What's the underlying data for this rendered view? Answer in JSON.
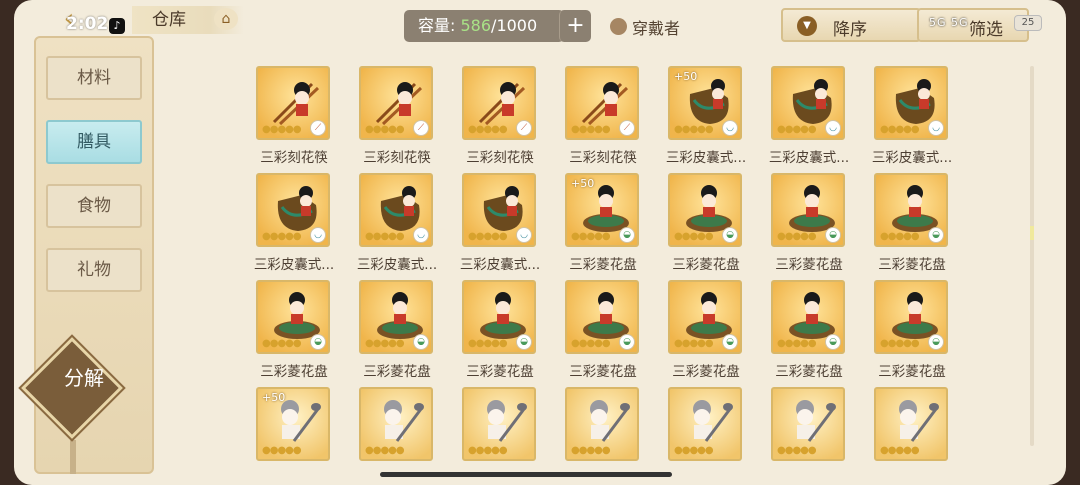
{
  "status": {
    "time": "2:02",
    "battery": "25",
    "signal": "5G 5G"
  },
  "header": {
    "back_icon": "back-arrow-icon",
    "title": "仓库",
    "capacity_label": "容量:",
    "capacity_used": "586",
    "capacity_total": "/1000",
    "add_label": "+",
    "wearer_label": "穿戴者",
    "sort_label": "降序",
    "filter_label": "筛选"
  },
  "sidebar": {
    "tabs": [
      {
        "label": "材料",
        "active": false
      },
      {
        "label": "膳具",
        "active": true
      },
      {
        "label": "食物",
        "active": false
      },
      {
        "label": "礼物",
        "active": false
      }
    ],
    "decompose_label": "分解"
  },
  "items": [
    {
      "name": "三彩刻花筷",
      "type": "chopsticks",
      "plus": "",
      "badge": "spoon"
    },
    {
      "name": "三彩刻花筷",
      "type": "chopsticks",
      "plus": "",
      "badge": "spoon"
    },
    {
      "name": "三彩刻花筷",
      "type": "chopsticks",
      "plus": "",
      "badge": "spoon"
    },
    {
      "name": "三彩刻花筷",
      "type": "chopsticks",
      "plus": "",
      "badge": "spoon"
    },
    {
      "name": "三彩皮囊式...",
      "type": "flask",
      "plus": "+50",
      "badge": "cup"
    },
    {
      "name": "三彩皮囊式...",
      "type": "flask",
      "plus": "",
      "badge": "cup"
    },
    {
      "name": "三彩皮囊式...",
      "type": "flask",
      "plus": "",
      "badge": "cup"
    },
    {
      "name": "三彩皮囊式...",
      "type": "flask",
      "plus": "",
      "badge": "cup"
    },
    {
      "name": "三彩皮囊式...",
      "type": "flask",
      "plus": "",
      "badge": "cup"
    },
    {
      "name": "三彩皮囊式...",
      "type": "flask",
      "plus": "",
      "badge": "cup"
    },
    {
      "name": "三彩菱花盘",
      "type": "plate",
      "plus": "+50",
      "badge": "bowl"
    },
    {
      "name": "三彩菱花盘",
      "type": "plate",
      "plus": "",
      "badge": "bowl"
    },
    {
      "name": "三彩菱花盘",
      "type": "plate",
      "plus": "",
      "badge": "bowl"
    },
    {
      "name": "三彩菱花盘",
      "type": "plate",
      "plus": "",
      "badge": "bowl"
    },
    {
      "name": "三彩菱花盘",
      "type": "plate",
      "plus": "",
      "badge": "bowl"
    },
    {
      "name": "三彩菱花盘",
      "type": "plate",
      "plus": "",
      "badge": "bowl"
    },
    {
      "name": "三彩菱花盘",
      "type": "plate",
      "plus": "",
      "badge": "bowl"
    },
    {
      "name": "三彩菱花盘",
      "type": "plate",
      "plus": "",
      "badge": "bowl"
    },
    {
      "name": "三彩菱花盘",
      "type": "plate",
      "plus": "",
      "badge": "bowl"
    },
    {
      "name": "三彩菱花盘",
      "type": "plate",
      "plus": "",
      "badge": "bowl"
    },
    {
      "name": "三彩菱花盘",
      "type": "plate",
      "plus": "",
      "badge": "bowl"
    },
    {
      "name": "",
      "type": "ladle",
      "plus": "+50",
      "badge": ""
    },
    {
      "name": "",
      "type": "ladle",
      "plus": "",
      "badge": ""
    },
    {
      "name": "",
      "type": "ladle",
      "plus": "",
      "badge": ""
    },
    {
      "name": "",
      "type": "ladle",
      "plus": "",
      "badge": ""
    },
    {
      "name": "",
      "type": "ladle",
      "plus": "",
      "badge": ""
    },
    {
      "name": "",
      "type": "ladle",
      "plus": "",
      "badge": ""
    },
    {
      "name": "",
      "type": "ladle",
      "plus": "",
      "badge": ""
    }
  ],
  "colors": {
    "accent_gold": "#d9b768",
    "active_tab": "#a9dde3",
    "capacity_green": "#a9e287"
  }
}
